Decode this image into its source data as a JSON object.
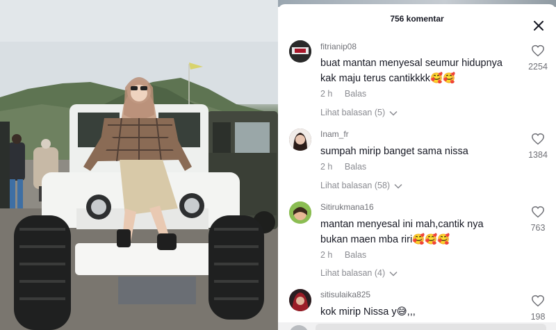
{
  "panel": {
    "title": "756 komentar",
    "close_icon": "close-icon"
  },
  "comments": [
    {
      "username": "fitrianip08",
      "text_lines": [
        "buat mantan menyesal seumur hidupnya",
        "kak maju terus cantikkkk🥰🥰"
      ],
      "time": "2 h",
      "reply_label": "Balas",
      "view_replies": "Lihat balasan (5)",
      "likes": "2254",
      "avatar_color": "#2a2a2a"
    },
    {
      "username": "Inam_fr",
      "text_lines": [
        "sumpah mirip banget sama nissa"
      ],
      "time": "2 h",
      "reply_label": "Balas",
      "view_replies": "Lihat balasan (58)",
      "likes": "1384",
      "avatar_color": "#3b2a26"
    },
    {
      "username": "Sitirukmana16",
      "text_lines": [
        "mantan menyesal ini mah,cantik nya",
        "bukan maen mba riri🥰🥰🥰"
      ],
      "time": "2 h",
      "reply_label": "Balas",
      "view_replies": "Lihat balasan (4)",
      "likes": "763",
      "avatar_color": "#7fb24a"
    },
    {
      "username": "sitisulaika825",
      "text_lines": [
        "kok mirip Nissa y😅,,,"
      ],
      "likes": "198",
      "avatar_color": "#8a1f24"
    }
  ],
  "colors": {
    "text_primary": "#161823",
    "text_secondary": "#8a8b91",
    "background": "#ffffff"
  }
}
